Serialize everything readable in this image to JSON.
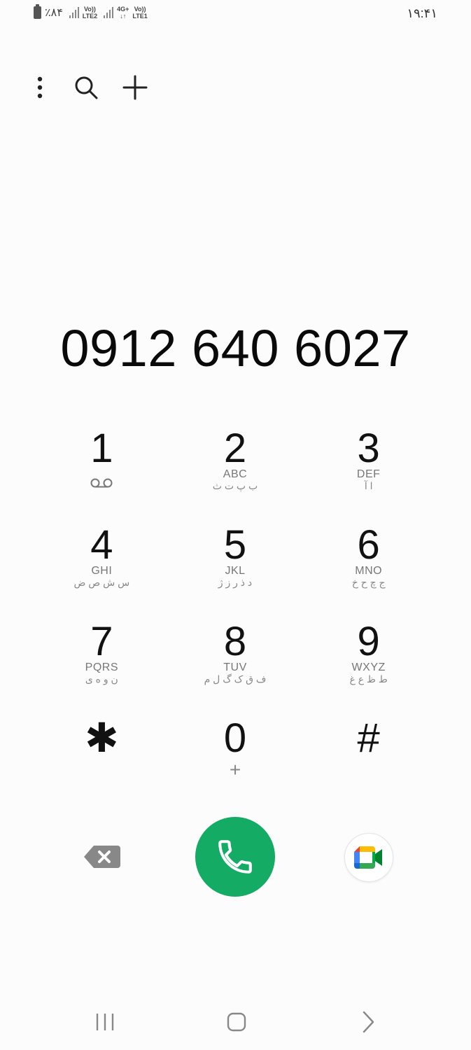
{
  "status_bar": {
    "battery_percent": "٪۸۴",
    "sim2": {
      "top": "Vo))",
      "bottom": "LTE2"
    },
    "sim1_network": {
      "top": "4G+",
      "bottom": "↓↑"
    },
    "sim1": {
      "top": "Vo))",
      "bottom": "LTE1"
    },
    "time": "۱۹:۴۱"
  },
  "toolbar": {
    "icons": [
      "more-vert-icon",
      "search-icon",
      "add-icon"
    ]
  },
  "dialer": {
    "number": "0912 640 6027"
  },
  "keypad": {
    "keys": [
      {
        "digit": "1",
        "latin": "",
        "persian": ""
      },
      {
        "digit": "2",
        "latin": "ABC",
        "persian": "ب پ ت ث"
      },
      {
        "digit": "3",
        "latin": "DEF",
        "persian": "ا آ"
      },
      {
        "digit": "4",
        "latin": "GHI",
        "persian": "س ش ص ض"
      },
      {
        "digit": "5",
        "latin": "JKL",
        "persian": "د ذ ر ز ژ"
      },
      {
        "digit": "6",
        "latin": "MNO",
        "persian": "ج چ ح خ"
      },
      {
        "digit": "7",
        "latin": "PQRS",
        "persian": "ن و ه ی"
      },
      {
        "digit": "8",
        "latin": "TUV",
        "persian": "ف ق ک گ ل م"
      },
      {
        "digit": "9",
        "latin": "WXYZ",
        "persian": "ط ظ ع غ"
      },
      {
        "digit": "✱",
        "latin": "",
        "persian": ""
      },
      {
        "digit": "0",
        "latin": "",
        "persian": "",
        "sub": "+"
      },
      {
        "digit": "#",
        "latin": "",
        "persian": ""
      }
    ]
  },
  "actions": {
    "backspace_icon": "backspace-icon",
    "call_icon": "phone-icon",
    "call_color": "#14ab65",
    "video_icon": "google-meet-icon"
  },
  "nav": {
    "icons": [
      "recent-apps-icon",
      "home-icon",
      "back-icon"
    ]
  }
}
